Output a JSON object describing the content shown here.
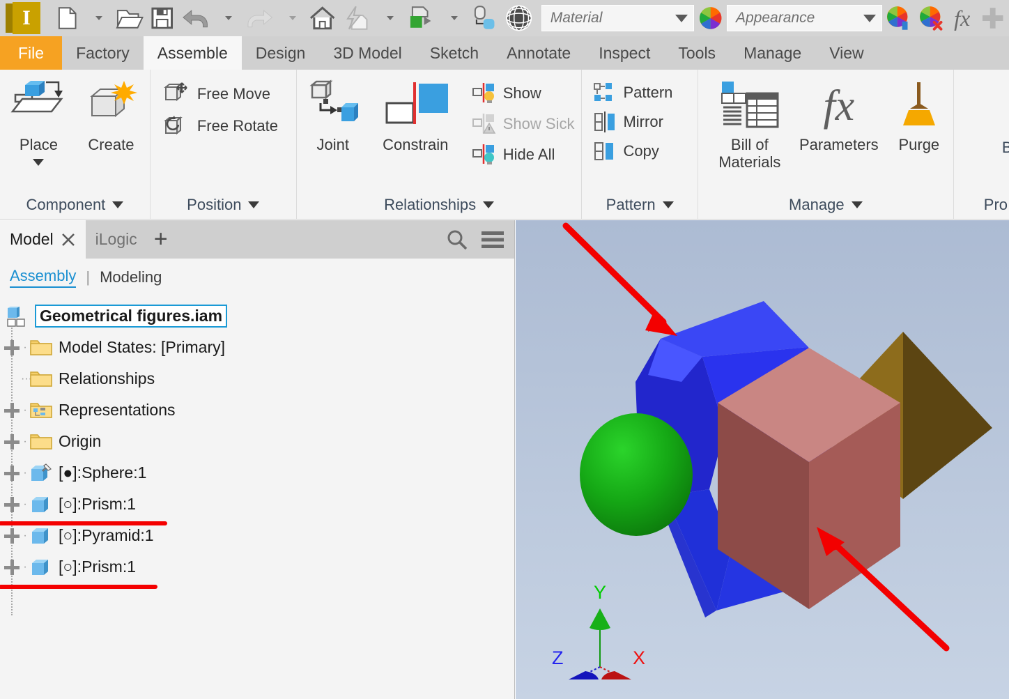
{
  "app": {
    "name": "Autodesk Inventor",
    "logo_letter": "I"
  },
  "quick_access": {
    "items": [
      {
        "name": "new-document-icon",
        "label": "New"
      },
      {
        "name": "new-dropdown-caret",
        "label": ""
      },
      {
        "name": "open-folder-icon",
        "label": "Open"
      },
      {
        "name": "save-icon",
        "label": "Save"
      },
      {
        "name": "undo-icon",
        "label": "Undo"
      },
      {
        "name": "undo-dropdown-caret",
        "label": ""
      },
      {
        "name": "redo-icon",
        "label": "Redo"
      },
      {
        "name": "redo-dropdown-caret",
        "label": ""
      },
      {
        "name": "home-icon",
        "label": "Home"
      },
      {
        "name": "lightning-document-icon",
        "label": "Quick Access"
      },
      {
        "name": "lightning-dropdown-caret",
        "label": ""
      },
      {
        "name": "update-icon",
        "label": "Update"
      },
      {
        "name": "update-dropdown-caret",
        "label": ""
      },
      {
        "name": "select-icon",
        "label": "Select"
      },
      {
        "name": "grid-sphere-icon",
        "label": "Display"
      }
    ],
    "material_select": {
      "value": "Material",
      "placeholder": "Material"
    },
    "appearance_select": {
      "value": "Appearance",
      "placeholder": "Appearance"
    },
    "right_icons": [
      {
        "name": "adjust-appearance-icon"
      },
      {
        "name": "clear-appearance-icon"
      },
      {
        "name": "fx-parameters-icon",
        "label": "fx"
      },
      {
        "name": "add-icon",
        "label": "+"
      }
    ]
  },
  "ribbon": {
    "tabs": [
      {
        "label": "File",
        "active": false,
        "file": true
      },
      {
        "label": "Factory",
        "active": false
      },
      {
        "label": "Assemble",
        "active": true
      },
      {
        "label": "Design",
        "active": false
      },
      {
        "label": "3D Model",
        "active": false
      },
      {
        "label": "Sketch",
        "active": false
      },
      {
        "label": "Annotate",
        "active": false
      },
      {
        "label": "Inspect",
        "active": false
      },
      {
        "label": "Tools",
        "active": false
      },
      {
        "label": "Manage",
        "active": false
      },
      {
        "label": "View",
        "active": false
      }
    ],
    "panels": [
      {
        "title": "Component",
        "big_buttons": [
          {
            "label": "Place",
            "icon": "place-component-icon",
            "has_dropdown": true
          },
          {
            "label": "Create",
            "icon": "create-component-icon",
            "has_dropdown": false
          }
        ],
        "small_buttons": []
      },
      {
        "title": "Position",
        "big_buttons": [],
        "small_buttons": [
          {
            "label": "Free Move",
            "icon": "free-move-icon",
            "disabled": false
          },
          {
            "label": "Free Rotate",
            "icon": "free-rotate-icon",
            "disabled": false
          }
        ]
      },
      {
        "title": "Relationships",
        "big_buttons": [
          {
            "label": "Joint",
            "icon": "joint-icon",
            "has_dropdown": false
          },
          {
            "label": "Constrain",
            "icon": "constrain-icon",
            "has_dropdown": false
          }
        ],
        "small_buttons": [
          {
            "label": "Show",
            "icon": "show-relationships-icon",
            "disabled": false
          },
          {
            "label": "Show Sick",
            "icon": "show-sick-icon",
            "disabled": true
          },
          {
            "label": "Hide All",
            "icon": "hide-all-icon",
            "disabled": false
          }
        ]
      },
      {
        "title": "Pattern",
        "big_buttons": [],
        "small_buttons": [
          {
            "label": "Pattern",
            "icon": "pattern-icon",
            "disabled": false
          },
          {
            "label": "Mirror",
            "icon": "mirror-icon",
            "disabled": false
          },
          {
            "label": "Copy",
            "icon": "copy-icon",
            "disabled": false
          }
        ]
      },
      {
        "title": "Manage",
        "big_buttons": [
          {
            "label": "Bill of Materials",
            "icon": "bill-of-materials-icon",
            "has_dropdown": false
          },
          {
            "label": "Parameters",
            "icon": "parameters-fx-icon",
            "has_dropdown": false
          },
          {
            "label": "Purge",
            "icon": "purge-broom-icon",
            "has_dropdown": false
          }
        ],
        "small_buttons": []
      },
      {
        "title": "Pro",
        "big_buttons": [
          {
            "label": "Brow",
            "icon": "browser-icon",
            "has_dropdown": false
          }
        ],
        "small_buttons": []
      }
    ]
  },
  "browser": {
    "tabs": [
      {
        "label": "Model",
        "active": true,
        "close_icon": "close-x-icon"
      },
      {
        "label": "iLogic",
        "active": false
      }
    ],
    "add_tab_label": "+",
    "tools": [
      {
        "name": "search-icon"
      },
      {
        "name": "hamburger-menu-icon"
      }
    ],
    "subtabs": [
      {
        "label": "Assembly",
        "selected": true
      },
      {
        "label": "Modeling",
        "selected": false
      }
    ],
    "subtab_divider": "|",
    "tree": {
      "root": {
        "label": "Geometrical figures.iam",
        "icon": "assembly-icon",
        "selected": true
      },
      "items": [
        {
          "label": "Model States: [Primary]",
          "icon": "folder-icon",
          "expandable": true,
          "underlined": false
        },
        {
          "label": "Relationships",
          "icon": "folder-icon",
          "expandable": false,
          "underlined": false
        },
        {
          "label": "Representations",
          "icon": "representations-folder-icon",
          "expandable": true,
          "underlined": false
        },
        {
          "label": "Origin",
          "icon": "folder-icon",
          "expandable": true,
          "underlined": false
        },
        {
          "label": "[●]:Sphere:1",
          "icon": "grounded-part-icon",
          "expandable": true,
          "underlined": false
        },
        {
          "label": "[○]:Prism:1",
          "icon": "part-icon",
          "expandable": true,
          "underlined": true
        },
        {
          "label": "[○]:Pyramid:1",
          "icon": "part-icon",
          "expandable": true,
          "underlined": false
        },
        {
          "label": "[○]:Prism:1",
          "icon": "part-icon",
          "expandable": true,
          "underlined": true
        }
      ]
    }
  },
  "viewport": {
    "background_top": "#acbbd3",
    "background_bottom": "#c6d2e3",
    "shapes": [
      {
        "name": "prism-blue",
        "color": "#2233ee",
        "label": "Prism"
      },
      {
        "name": "pyramid-olive",
        "color": "#8a6a1e",
        "label": "Pyramid"
      },
      {
        "name": "sphere-green",
        "color": "#19a219",
        "label": "Sphere"
      },
      {
        "name": "cube-red",
        "color": "#b5625e",
        "label": "Prism"
      }
    ],
    "annotations": [
      {
        "name": "arrow-to-prism",
        "color": "#f40000"
      },
      {
        "name": "arrow-to-cube",
        "color": "#f40000"
      }
    ],
    "axis_triad": {
      "x_label": "X",
      "x_color": "#dd0000",
      "y_label": "Y",
      "y_color": "#00bb00",
      "z_label": "Z",
      "z_color": "#1a1aee"
    }
  }
}
